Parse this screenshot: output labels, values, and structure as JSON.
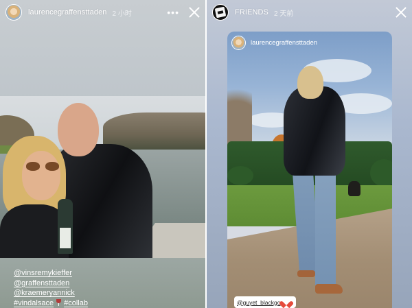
{
  "left_story": {
    "username": "laurencegraffensttaden",
    "time": "2 小时",
    "more_label": "•••",
    "mentions": [
      "@vinsremykieffer",
      "@graffensttaden",
      "@kraemeryannick",
      "#vindalsace",
      "#collab"
    ]
  },
  "right_story": {
    "username": "FRIENDS",
    "time": "2 天前",
    "card": {
      "username": "laurencegraffensttaden",
      "tag_sticker": "@guyet_blackgo"
    }
  },
  "icons": {
    "close": "close-icon",
    "more": "more-icon",
    "heart": "heart-icon",
    "wine": "wine-glass-icon"
  },
  "colors": {
    "text": "#ffffff",
    "sticker_bg": "#ffffff",
    "heart": "#e64b3c"
  }
}
